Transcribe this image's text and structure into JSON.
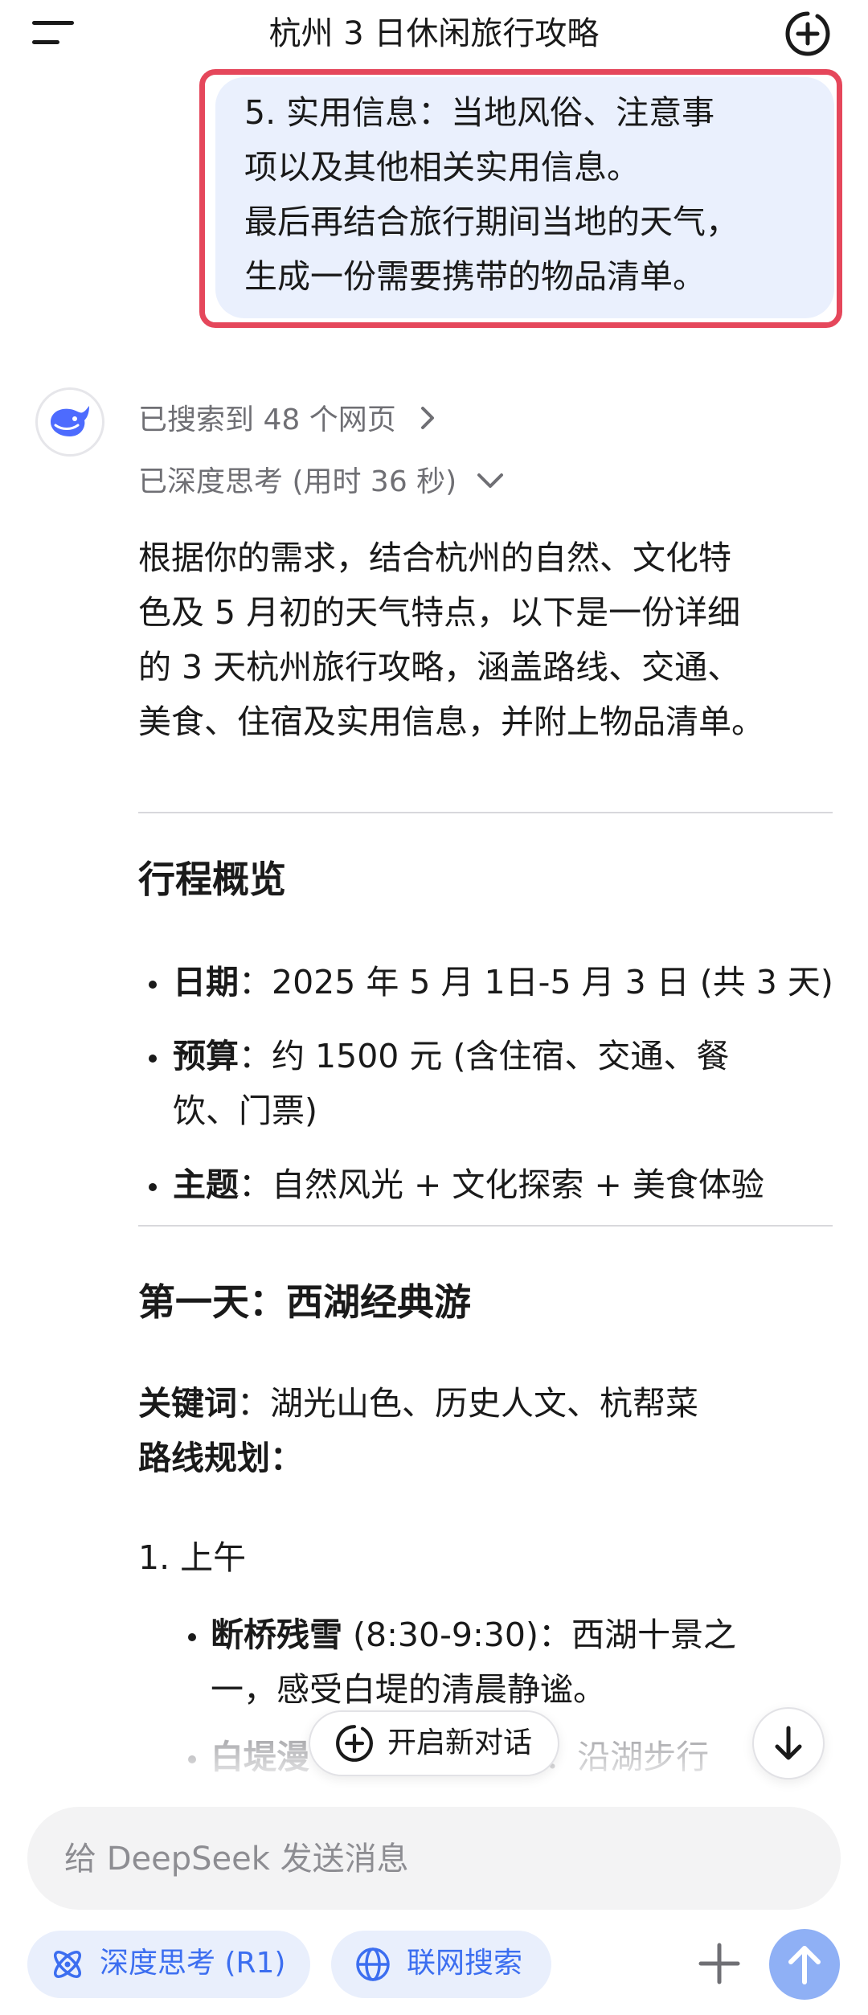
{
  "header": {
    "title": "杭州 3 日休闲旅行攻略",
    "menu_icon": "menu-icon",
    "new_chat_icon": "plus-circle-icon"
  },
  "user_message": {
    "lines": [
      "5. 实用信息：当地风俗、注意事",
      "项以及其他相关实用信息。",
      "最后再结合旅行期间当地的天气，",
      "生成一份需要携带的物品清单。"
    ]
  },
  "assistant": {
    "avatar_icon": "deepseek-whale-icon",
    "search_status": "已搜索到 48 个网页",
    "think_status": "已深度思考 (用时 36 秒)",
    "intro_lines": [
      "根据你的需求，结合杭州的自然、文化特",
      "色及 5 月初的天气特点，以下是一份详细",
      "的 3 天杭州旅行攻略，涵盖路线、交通、",
      "美食、住宿及实用信息，并附上物品清单。"
    ],
    "overview": {
      "heading": "行程概览",
      "items": [
        {
          "key": "日期",
          "value": "2025 年 5 月 1日-5 月 3 日 (共 3 天)"
        },
        {
          "key": "预算",
          "value": "约 1500 元 (含住宿、交通、餐",
          "value_cont": "饮、门票)"
        },
        {
          "key": "主题",
          "value": "自然风光 + 文化探索 + 美食体验"
        }
      ]
    },
    "day1": {
      "heading": "第一天：西湖经典游",
      "keywords_key": "关键词",
      "keywords_value": "湖光山色、历史人文、杭帮菜",
      "route_label": "路线规划：",
      "section": "1. 上午",
      "items": [
        {
          "key": "断桥残雪",
          "value": " (8:30-9:30)：西湖十景之",
          "value_cont": "一，感受白堤的清晨静谧。"
        },
        {
          "key": "白堤漫",
          "value": "0)：沿湖步行"
        }
      ]
    }
  },
  "floating": {
    "new_chat_label": "开启新对话",
    "new_chat_icon": "plus-circle-icon",
    "scroll_down_icon": "arrow-down-icon"
  },
  "composer": {
    "placeholder": "给 DeepSeek 发送消息",
    "deep_think_label": "深度思考 (R1)",
    "deep_think_icon": "atom-icon",
    "web_search_label": "联网搜索",
    "web_search_icon": "globe-icon",
    "attach_icon": "plus-icon",
    "send_icon": "arrow-up-icon"
  },
  "colors": {
    "accent": "#3c6ef0",
    "bubble_bg": "#eaf0fd",
    "highlight_border": "#e5475b",
    "send_button": "#8fb0f5"
  }
}
